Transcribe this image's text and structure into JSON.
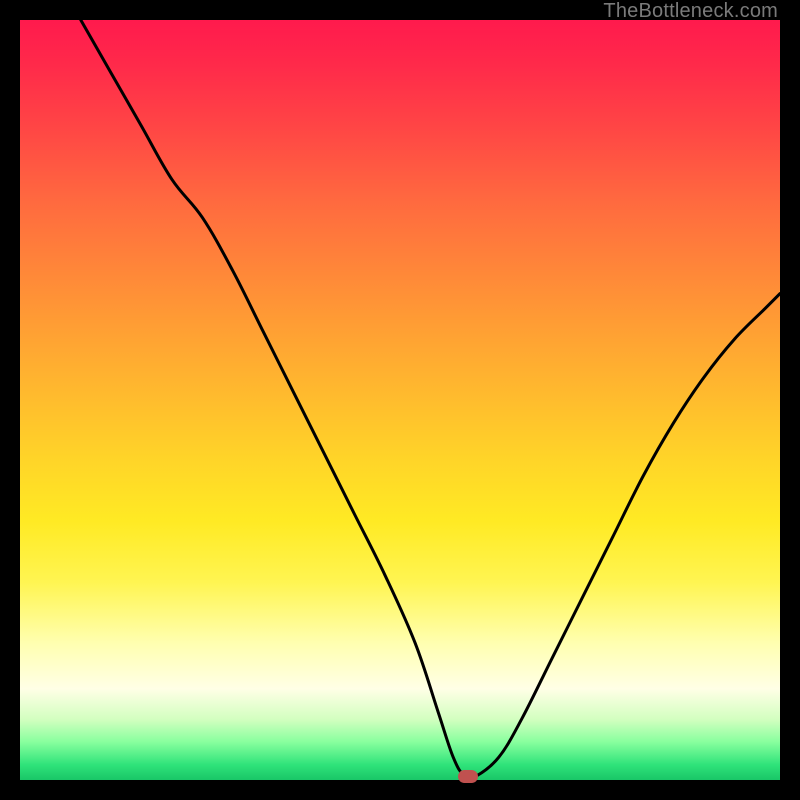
{
  "watermark": "TheBottleneck.com",
  "colors": {
    "frame": "#000000",
    "gradient_top": "#ff1a4d",
    "gradient_bottom": "#19c667",
    "curve": "#000000",
    "marker": "#c0514f",
    "watermark": "#7a7a7a"
  },
  "chart_data": {
    "type": "line",
    "title": "",
    "xlabel": "",
    "ylabel": "",
    "xlim": [
      0,
      100
    ],
    "ylim": [
      0,
      100
    ],
    "grid": false,
    "legend": false,
    "series": [
      {
        "name": "bottleneck-curve",
        "x": [
          8,
          12,
          16,
          20,
          24,
          28,
          32,
          36,
          40,
          44,
          48,
          52,
          55,
          57,
          58.5,
          60,
          63,
          66,
          70,
          74,
          78,
          82,
          86,
          90,
          94,
          98,
          100
        ],
        "y": [
          100,
          93,
          86,
          79,
          74,
          67,
          59,
          51,
          43,
          35,
          27,
          18,
          9,
          3,
          0.5,
          0.5,
          3,
          8,
          16,
          24,
          32,
          40,
          47,
          53,
          58,
          62,
          64
        ]
      }
    ],
    "marker": {
      "x": 59,
      "y": 0.5
    },
    "annotations": []
  }
}
